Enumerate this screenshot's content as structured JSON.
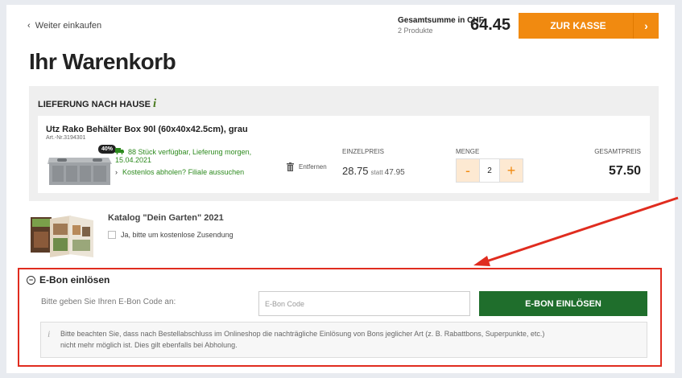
{
  "header": {
    "back_link": "Weiter einkaufen",
    "total_label": "Gesamtsumme in CHF",
    "product_count": "2 Produkte",
    "total_amount": "64.45",
    "checkout_label": "ZUR KASSE",
    "checkout_chevron": "›"
  },
  "page_title": "Ihr Warenkorb",
  "delivery": {
    "heading": "LIEFERUNG NACH HAUSE",
    "info_icon": "i",
    "item": {
      "name": "Utz Rako Behälter Box 90l (60x40x42.5cm), grau",
      "article": "Art.-Nr.3194301",
      "discount_badge": "40%",
      "availability": "88 Stück verfügbar, Lieferung morgen, 15.04.2021",
      "pickup": "Kostenlos abholen? Filiale aussuchen",
      "remove_label": "Entfernen",
      "unit_price_label": "EINZELPREIS",
      "unit_price": "28.75",
      "statt_label": "statt",
      "old_price": "47.95",
      "quantity_label": "MENGE",
      "quantity": "2",
      "minus": "-",
      "plus": "+",
      "total_label": "GESAMTPREIS",
      "total": "57.50"
    }
  },
  "catalog": {
    "title": "Katalog \"Dein Garten\" 2021",
    "checkbox_label": "Ja, bitte um kostenlose Zusendung"
  },
  "ebon": {
    "heading": "E-Bon einlösen",
    "prompt": "Bitte geben Sie Ihren E-Bon Code an:",
    "input_placeholder": "E-Bon Code",
    "button_label": "E-BON EINLÖSEN",
    "note_line1": "Bitte beachten Sie, dass nach Bestellabschluss im Onlineshop die nachträgliche Einlösung von Bons jeglicher Art (z. B. Rabattbons, Superpunkte, etc.)",
    "note_line2": "nicht mehr möglich ist. Dies gilt ebenfalls bei Abholung."
  },
  "colors": {
    "accent_orange": "#f18a10",
    "redeem_green": "#1f6e2c",
    "availability_green": "#2d8a1e",
    "annotation_red": "#e02c1f"
  },
  "icons": {
    "back": "chevron-left-icon",
    "truck": "truck-icon",
    "trash": "trash-icon",
    "collapse": "minus-circle-icon",
    "info": "info-icon"
  }
}
